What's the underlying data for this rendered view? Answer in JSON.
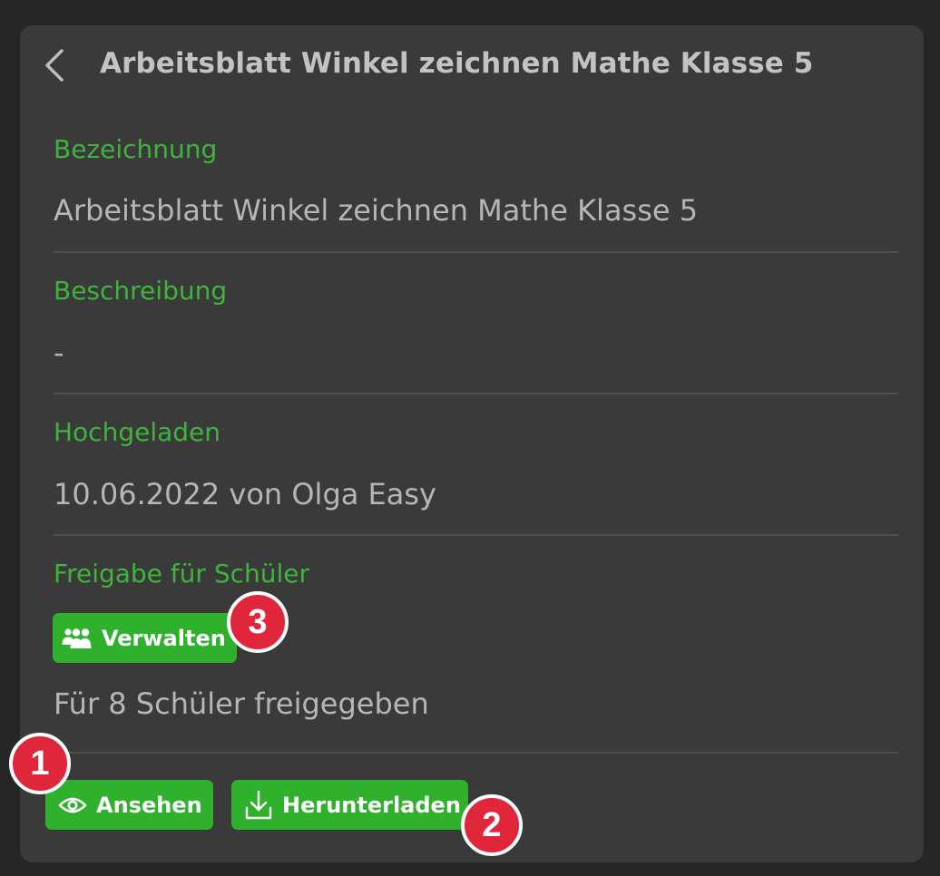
{
  "header": {
    "back_icon": "chevron-left-icon",
    "title": "Arbeitsblatt Winkel zeichnen Mathe Klasse 5"
  },
  "fields": {
    "bezeichnung": {
      "label": "Bezeichnung",
      "value": "Arbeitsblatt Winkel zeichnen Mathe Klasse 5"
    },
    "beschreibung": {
      "label": "Beschreibung",
      "value": "-"
    },
    "hochgeladen": {
      "label": "Hochgeladen",
      "value": "10.06.2022 von Olga Easy"
    },
    "freigabe": {
      "label": "Freigabe für Schüler",
      "manage_button": "Verwalten",
      "manage_icon": "users-icon",
      "status": "Für 8 Schüler freigegeben"
    }
  },
  "actions": {
    "view_button": "Ansehen",
    "view_icon": "eye-icon",
    "download_button": "Herunterladen",
    "download_icon": "download-icon"
  },
  "badges": {
    "view": "1",
    "download": "2",
    "manage": "3"
  },
  "colors": {
    "accent": "#2fb12e",
    "label_green": "#3fb43a",
    "badge_red": "#e0263a",
    "panel_bg": "#3a3a3a",
    "page_bg": "#262626"
  }
}
